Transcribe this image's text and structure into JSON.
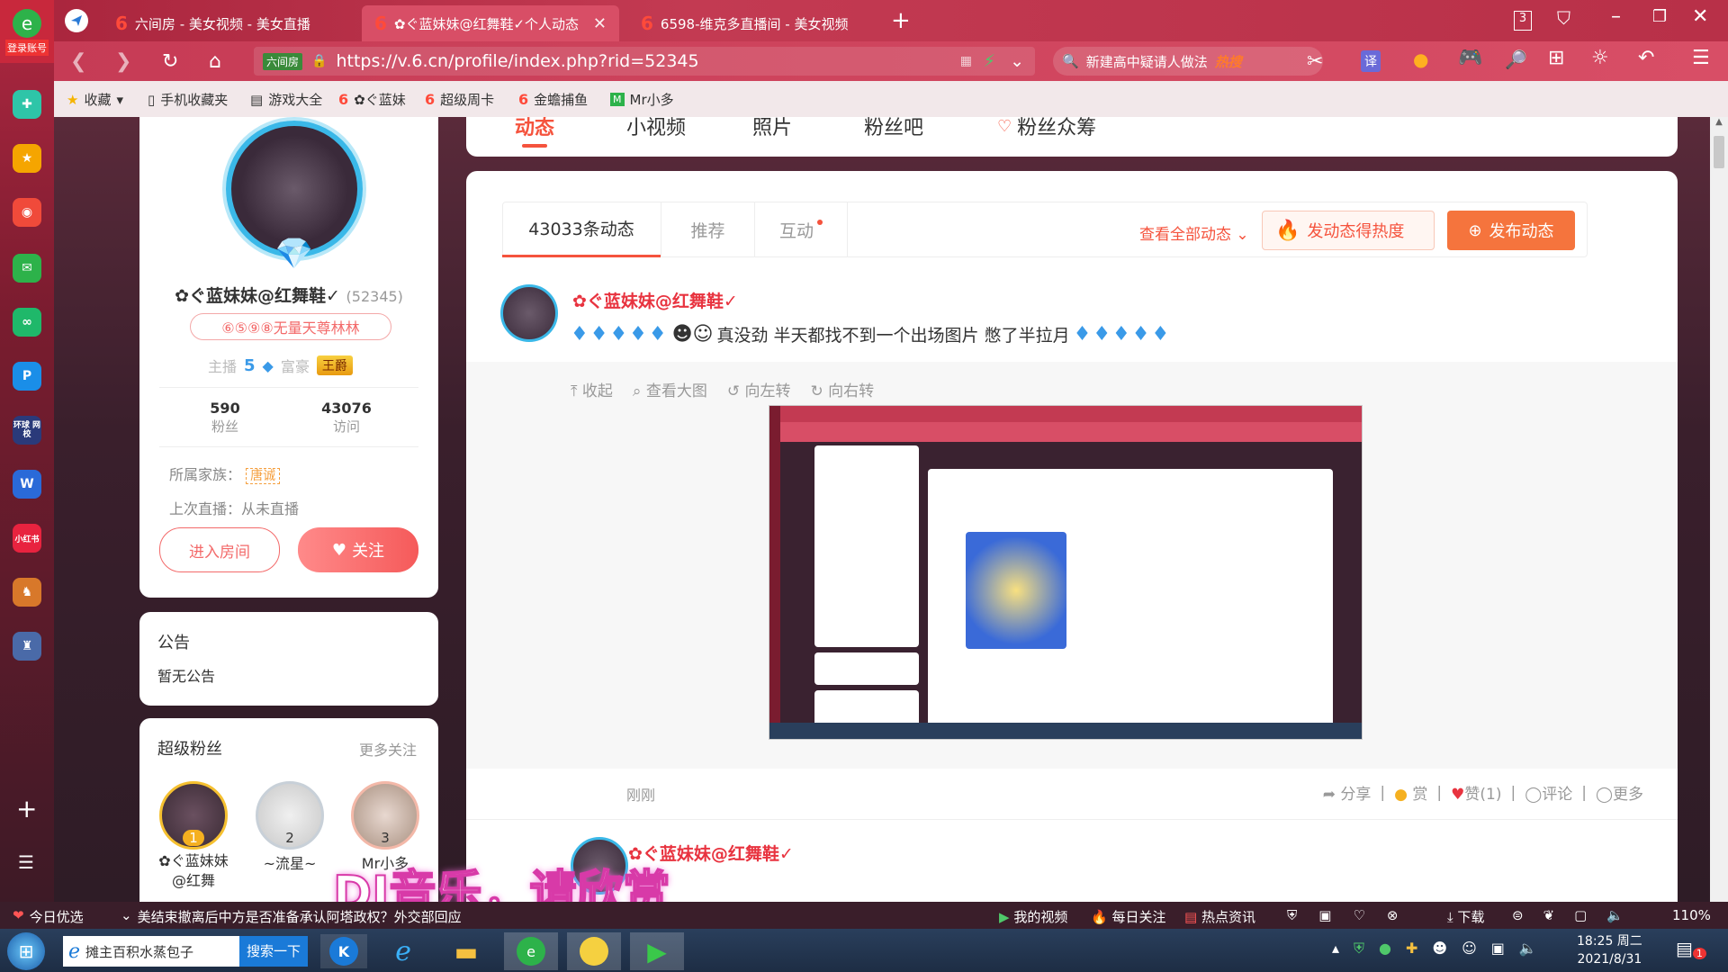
{
  "browser": {
    "login_label": "登录账号",
    "tabs": [
      {
        "label": "六间房 - 美女视频 - 美女直播"
      },
      {
        "label": "✿ぐ蓝妹妹@红舞鞋✓个人动态"
      },
      {
        "label": "6598-维克多直播间 - 美女视频"
      }
    ],
    "tab_count": "3",
    "site_badge": "六间房",
    "url": "https://v.6.cn/profile/index.php?rid=52345",
    "search_text": "新建高中疑请人做法",
    "search_hot": "热搜",
    "translate_label": "译",
    "bookmarks": [
      {
        "label": "收藏"
      },
      {
        "label": "手机收藏夹"
      },
      {
        "label": "游戏大全"
      },
      {
        "label": "✿ぐ蓝妹"
      },
      {
        "label": "超级周卡"
      },
      {
        "label": "金蟾捕鱼"
      },
      {
        "label": "Mr小多"
      }
    ]
  },
  "leftbar": {
    "apps": [
      "gift",
      "star",
      "weibo",
      "mail",
      "cloud",
      "pay",
      "news",
      "doc",
      "hongbao",
      "game1",
      "game2"
    ],
    "app_text": {
      "news": "环球 网校",
      "hongbao": "小红书"
    }
  },
  "profile_nav": {
    "tabs": [
      "动态",
      "小视频",
      "照片",
      "粉丝吧",
      "粉丝众筹"
    ]
  },
  "profile": {
    "name": "✿ぐ蓝妹妹@红舞鞋✓",
    "rid": "(52345)",
    "badge": "⑥⑤⑨⑧无量天尊林林",
    "anchor_label": "主播",
    "anchor_level": "5",
    "rich_label": "富豪",
    "rich_title": "王爵",
    "fans_count": "590",
    "fans_label": "粉丝",
    "visits_count": "43076",
    "visits_label": "访问",
    "family_label": "所属家族：",
    "family_value": "唐诚",
    "last_live": "上次直播：从未直播",
    "enter_room": "进入房间",
    "follow": "关注"
  },
  "notice": {
    "title": "公告",
    "content": "暂无公告"
  },
  "superfans": {
    "title": "超级粉丝",
    "more": "更多关注",
    "fans": [
      {
        "rank": "1",
        "name": "✿ぐ蓝妹妹@红舞"
      },
      {
        "rank": "2",
        "name": "~流星~"
      },
      {
        "rank": "3",
        "name": "Mr小多"
      }
    ]
  },
  "feed": {
    "tabs": [
      "43033条动态",
      "推荐",
      "互动"
    ],
    "view_all": "查看全部动态",
    "hot_label": "发动态得热度",
    "publish": "发布动态",
    "post": {
      "author": "✿ぐ蓝妹妹@红舞鞋✓",
      "text": "真没劲 半天都找不到一个出场图片 憋了半拉月",
      "actions": [
        "收起",
        "查看大图",
        "向左转",
        "向右转"
      ],
      "time": "刚刚",
      "share": "分享",
      "reward": "赏",
      "like": "赞(1)",
      "comment": "评论",
      "more": "更多"
    },
    "post2_author": "✿ぐ蓝妹妹@红舞鞋✓"
  },
  "overlay_text": "DJ音乐，请欣赏",
  "statusbar": {
    "daily": "今日优选",
    "headline": "美结束撤离后中方是否准备承认阿塔政权？外交部回应",
    "items": [
      "我的视频",
      "每日关注",
      "热点资讯",
      "下载"
    ],
    "zoom": "110%"
  },
  "taskbar": {
    "ie_text": "摊主百积水蒸包子",
    "search_btn": "搜索一下",
    "time": "18:25 周二",
    "date": "2021/8/31",
    "notify_count": "1"
  },
  "colors": {
    "accent": "#f5533d",
    "brand_red": "#e8333f",
    "follow_pink": "#ff6b6b"
  }
}
